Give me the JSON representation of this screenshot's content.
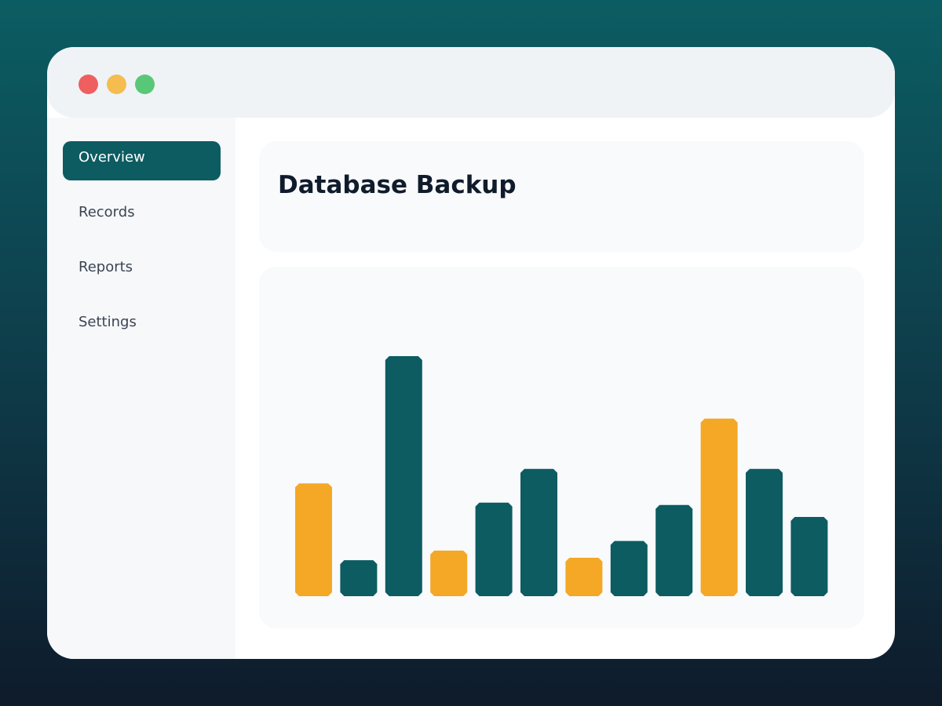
{
  "window": {
    "controls": [
      {
        "name": "close",
        "color": "#ef5f5f"
      },
      {
        "name": "minimize",
        "color": "#f5bd4f"
      },
      {
        "name": "maximize",
        "color": "#58c878"
      }
    ]
  },
  "sidebar": {
    "items": [
      {
        "label": "Overview",
        "active": true
      },
      {
        "label": "Records",
        "active": false
      },
      {
        "label": "Reports",
        "active": false
      },
      {
        "label": "Settings",
        "active": false
      }
    ]
  },
  "main": {
    "title": "Database Backup"
  },
  "colors": {
    "accent": "#0c5c62",
    "highlight": "#f4a825"
  },
  "chart_data": {
    "type": "bar",
    "title": "",
    "xlabel": "",
    "ylabel": "",
    "ylim": [
      0,
      100
    ],
    "grid": false,
    "legend": "none",
    "values": [
      47,
      15,
      100,
      19,
      39,
      53,
      16,
      23,
      38,
      74,
      53,
      33
    ],
    "highlighted": [
      true,
      false,
      false,
      true,
      false,
      false,
      true,
      false,
      false,
      true,
      false,
      false
    ]
  }
}
